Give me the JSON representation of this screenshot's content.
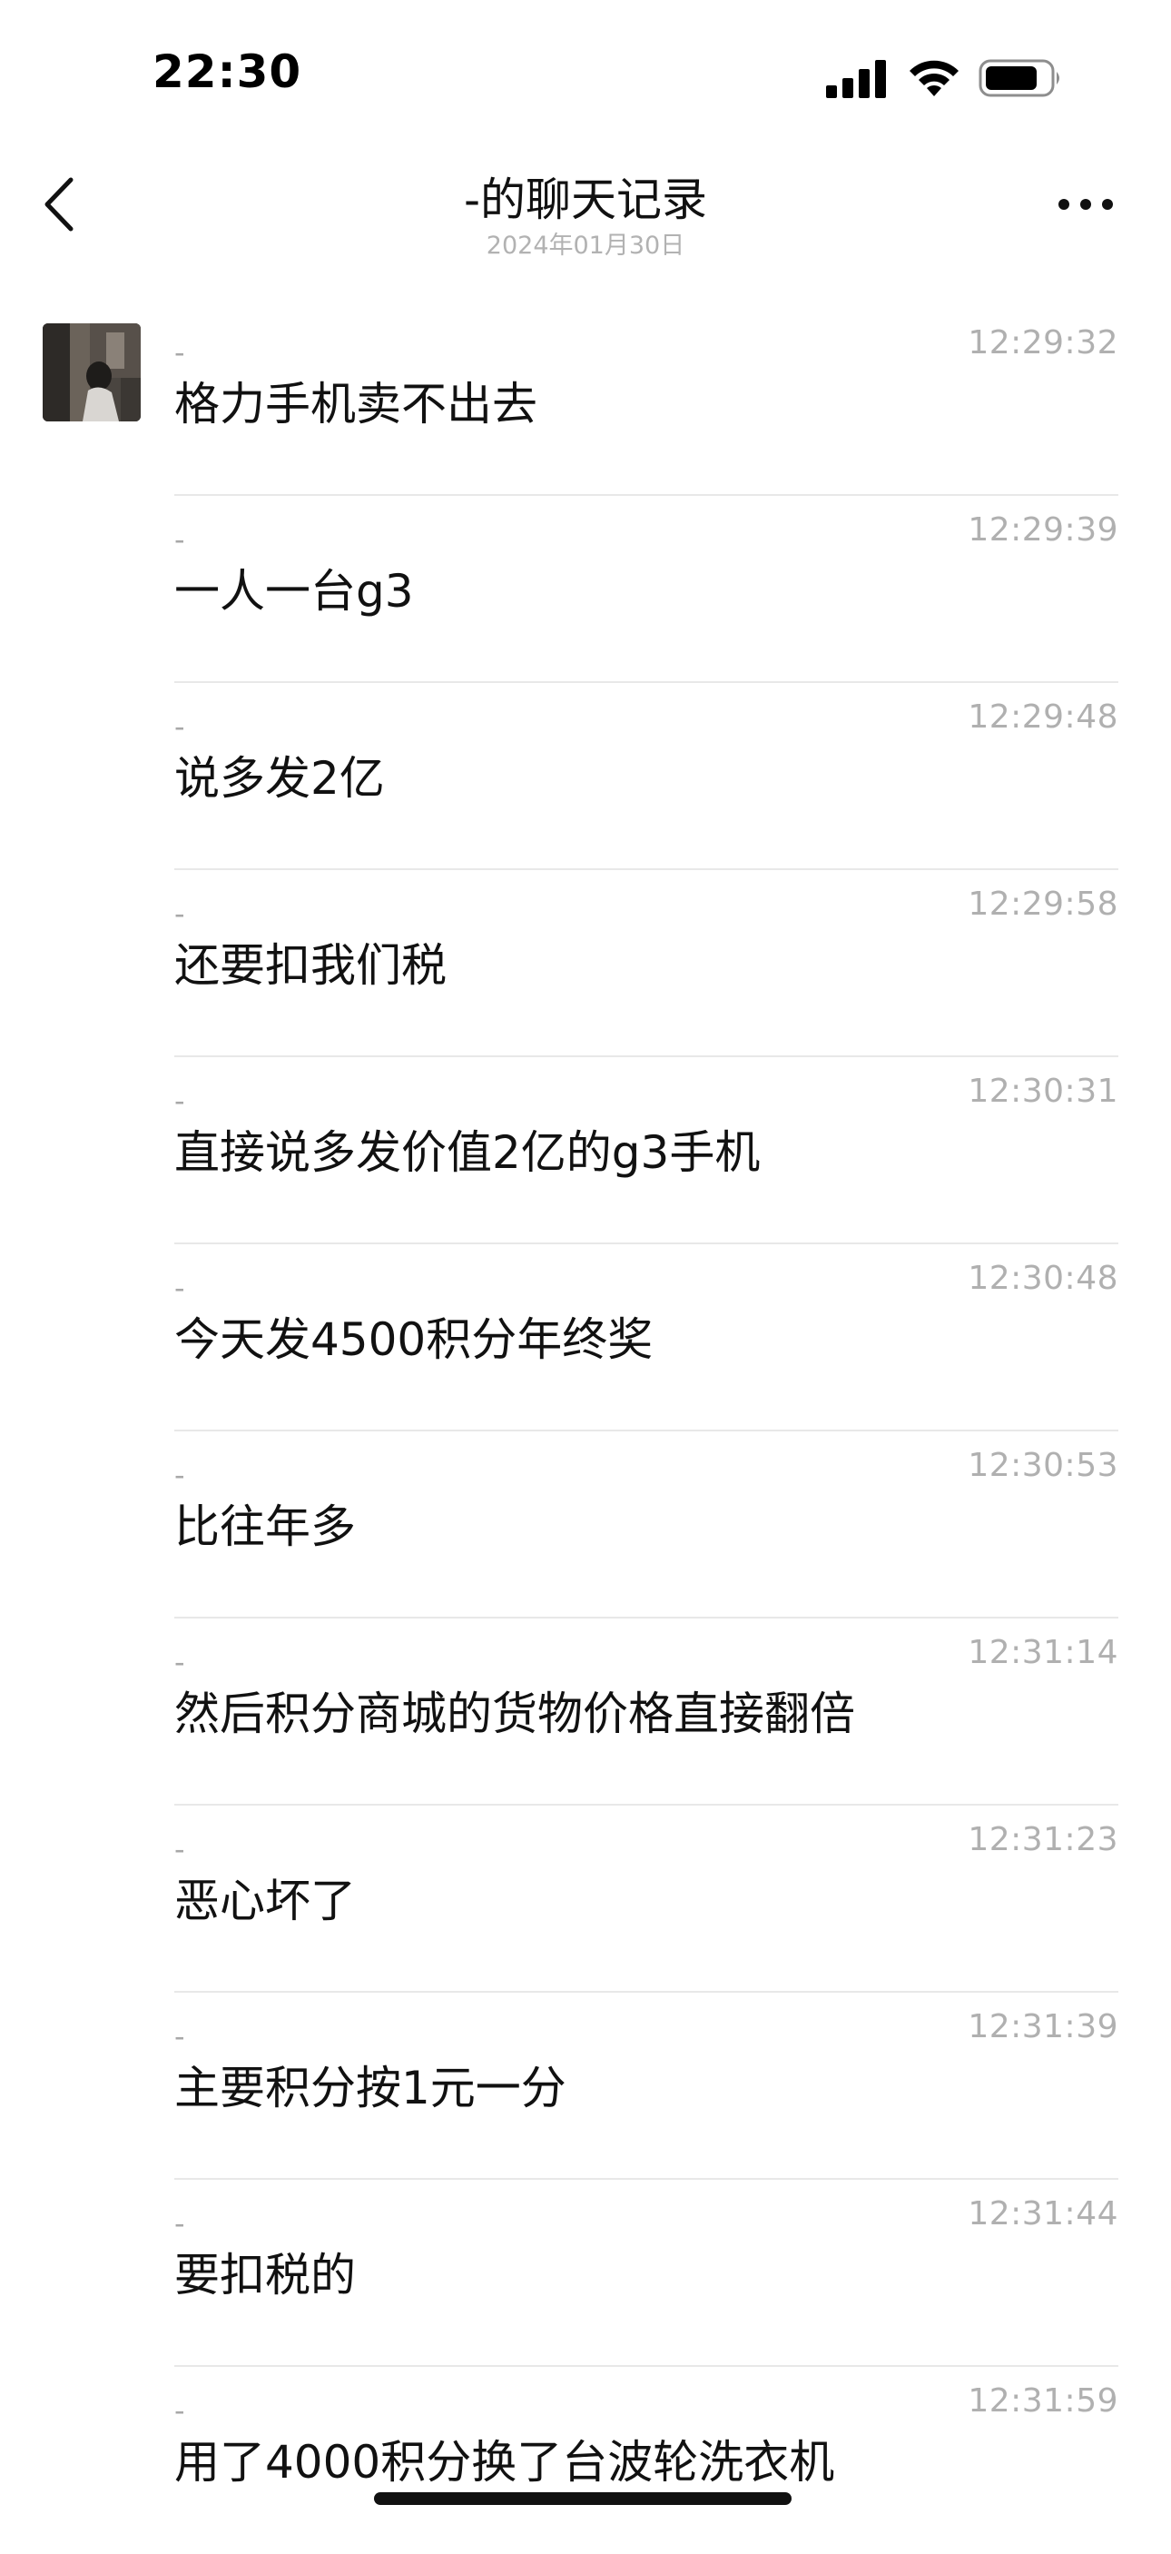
{
  "status_bar": {
    "time": "22:30"
  },
  "header": {
    "title": "-的聊天记录",
    "subtitle": "2024年01月30日"
  },
  "icons": {
    "back": "chevron-left-icon",
    "more": "more-dots-icon",
    "signal": "cellular-signal-icon",
    "wifi": "wifi-icon",
    "battery": "battery-icon"
  },
  "colors": {
    "text_primary": "#111111",
    "text_secondary": "#b0b0b0",
    "divider": "#e8e8e8",
    "background": "#ffffff"
  },
  "messages": [
    {
      "sender": "-",
      "time": "12:29:32",
      "text": "格力手机卖不出去"
    },
    {
      "sender": "-",
      "time": "12:29:39",
      "text": "一人一台g3"
    },
    {
      "sender": "-",
      "time": "12:29:48",
      "text": "说多发2亿"
    },
    {
      "sender": "-",
      "time": "12:29:58",
      "text": "还要扣我们税"
    },
    {
      "sender": "-",
      "time": "12:30:31",
      "text": "直接说多发价值2亿的g3手机"
    },
    {
      "sender": "-",
      "time": "12:30:48",
      "text": "今天发4500积分年终奖"
    },
    {
      "sender": "-",
      "time": "12:30:53",
      "text": "比往年多"
    },
    {
      "sender": "-",
      "time": "12:31:14",
      "text": "然后积分商城的货物价格直接翻倍"
    },
    {
      "sender": "-",
      "time": "12:31:23",
      "text": "恶心坏了"
    },
    {
      "sender": "-",
      "time": "12:31:39",
      "text": "主要积分按1元一分"
    },
    {
      "sender": "-",
      "time": "12:31:44",
      "text": "要扣税的"
    },
    {
      "sender": "-",
      "time": "12:31:59",
      "text": "用了4000积分换了台波轮洗衣机"
    }
  ]
}
